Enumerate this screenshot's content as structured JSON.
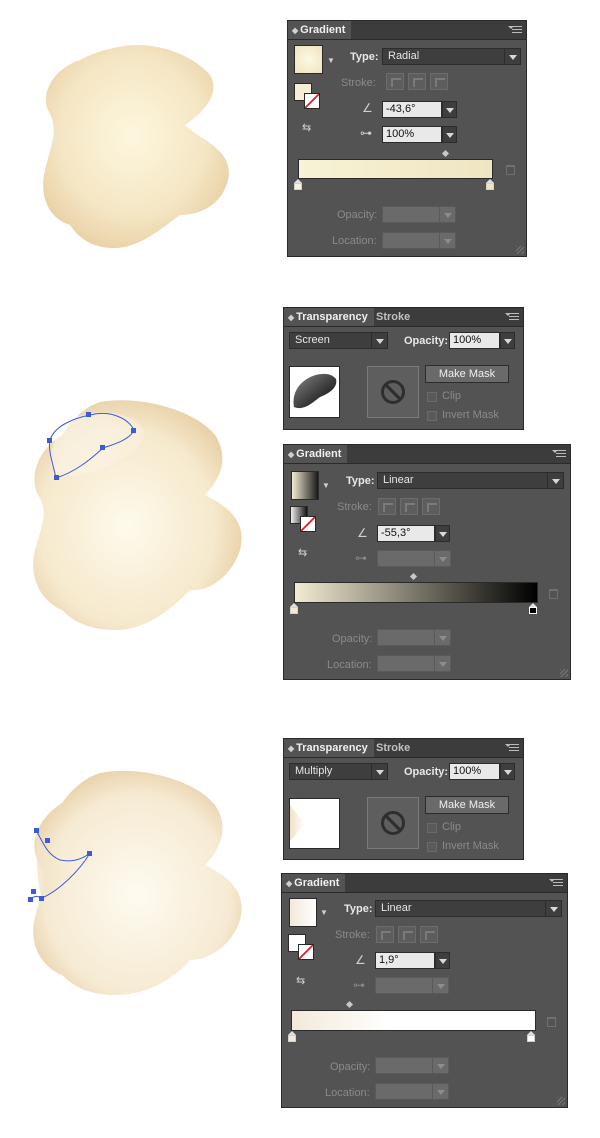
{
  "panels": {
    "gradient_radial": {
      "title": "Gradient",
      "type_label": "Type:",
      "type_value": "Radial",
      "stroke_label": "Stroke:",
      "angle_value": "-43,6°",
      "ratio_value": "100%",
      "opacity_label": "Opacity:",
      "location_label": "Location:",
      "gradient_colors": [
        "#f8f3d6",
        "#efe5c0"
      ]
    },
    "transparency_screen": {
      "tab_active": "Transparency",
      "tab_inactive": "Stroke",
      "blend_mode": "Screen",
      "opacity_label": "Opacity:",
      "opacity_value": "100%",
      "make_mask_label": "Make Mask",
      "clip_label": "Clip",
      "invert_mask_label": "Invert Mask"
    },
    "gradient_linear_1": {
      "title": "Gradient",
      "type_label": "Type:",
      "type_value": "Linear",
      "stroke_label": "Stroke:",
      "angle_value": "-55,3°",
      "opacity_label": "Opacity:",
      "location_label": "Location:",
      "gradient_colors": [
        "#f3ebd2",
        "#000000"
      ]
    },
    "transparency_multiply": {
      "tab_active": "Transparency",
      "tab_inactive": "Stroke",
      "blend_mode": "Multiply",
      "opacity_label": "Opacity:",
      "opacity_value": "100%",
      "make_mask_label": "Make Mask",
      "clip_label": "Clip",
      "invert_mask_label": "Invert Mask"
    },
    "gradient_linear_2": {
      "title": "Gradient",
      "type_label": "Type:",
      "type_value": "Linear",
      "stroke_label": "Stroke:",
      "angle_value": "1,9°",
      "opacity_label": "Opacity:",
      "location_label": "Location:",
      "gradient_colors": [
        "#f3e9d8",
        "#ffffff"
      ]
    }
  },
  "colors": {
    "panel_bg": "#535353",
    "blob_light": "#fdf8e8",
    "blob_dark": "#e9cfa6",
    "path_blue": "#3d5bd9"
  }
}
